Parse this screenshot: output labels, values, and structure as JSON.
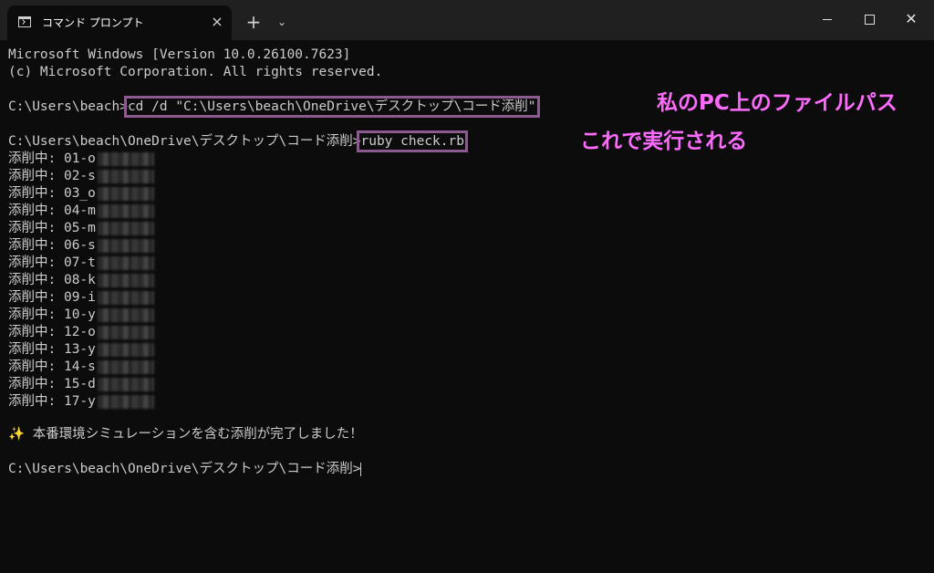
{
  "window": {
    "tab_title": "コマンド プロンプト",
    "tab_close": "×",
    "new_tab": "+",
    "dropdown": "⌄",
    "close": "✕"
  },
  "console": {
    "header1": "Microsoft Windows [Version 10.0.26100.7623]",
    "header2": "(c) Microsoft Corporation. All rights reserved.",
    "prompt1": "C:\\Users\\beach>",
    "command1": "cd /d \"C:\\Users\\beach\\OneDrive\\デスクトップ\\コード添削\"",
    "prompt2": "C:\\Users\\beach\\OneDrive\\デスクトップ\\コード添削>",
    "command2": "ruby check.rb",
    "output": [
      "添削中: 01-o",
      "添削中: 02-s",
      "添削中: 03_o",
      "添削中: 04-m",
      "添削中: 05-m",
      "添削中: 06-s",
      "添削中: 07-t",
      "添削中: 08-k",
      "添削中: 09-i",
      "添削中: 10-y",
      "添削中: 12-o",
      "添削中: 13-y",
      "添削中: 14-s",
      "添削中: 15-d",
      "添削中: 17-y"
    ],
    "completion": "✨ 本番環境シミュレーションを含む添削が完了しました！",
    "prompt3": "C:\\Users\\beach\\OneDrive\\デスクトップ\\コード添削>"
  },
  "annotations": {
    "path_note": "私のPC上のファイルパス",
    "run_note": "これで実行される"
  },
  "colors": {
    "background": "#0c0c0c",
    "titlebar": "#202020",
    "text": "#cccccc",
    "highlight_box": "#8b5a8e",
    "annotation": "#ff6bff"
  }
}
